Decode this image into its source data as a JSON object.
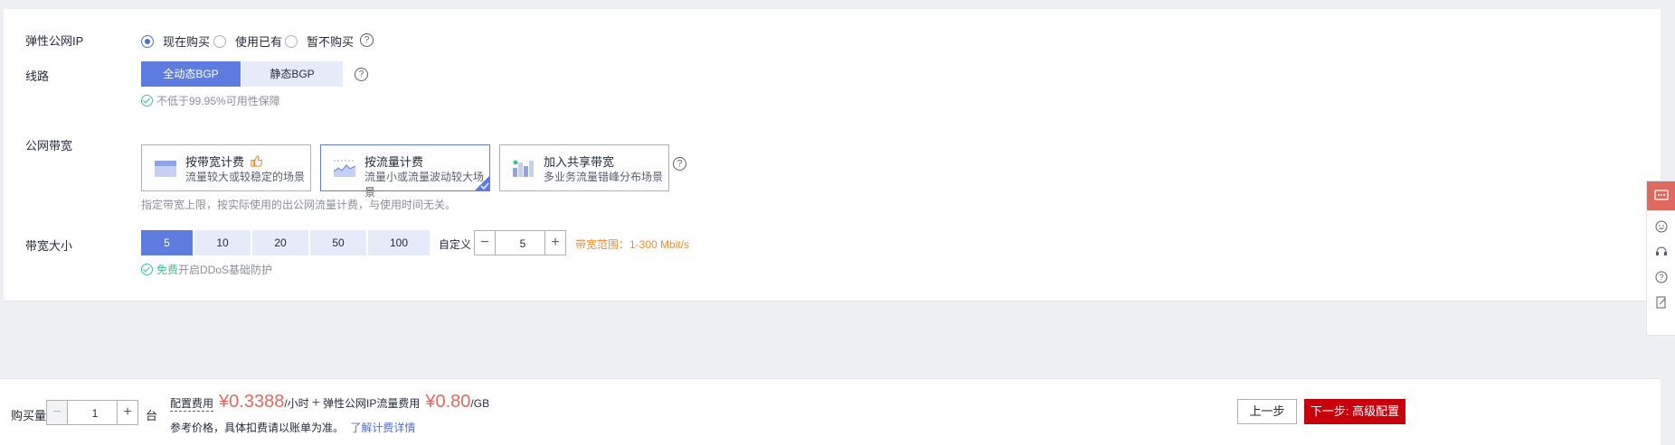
{
  "eip": {
    "label": "弹性公网IP",
    "options": [
      {
        "label": "现在购买",
        "checked": true
      },
      {
        "label": "使用已有",
        "checked": false
      },
      {
        "label": "暂不购买",
        "checked": false
      }
    ]
  },
  "line": {
    "label": "线路",
    "options": [
      {
        "label": "全动态BGP",
        "selected": true
      },
      {
        "label": "静态BGP",
        "selected": false
      }
    ],
    "note": "不低于99.95%可用性保障"
  },
  "bandwidth": {
    "label": "公网带宽",
    "cards": [
      {
        "title": "按带宽计费",
        "subtitle": "流量较大或较稳定的场景",
        "selected": false,
        "icon": "bandwidth-billing-icon"
      },
      {
        "title": "按流量计费",
        "subtitle": "流量小或流量波动较大场景",
        "selected": true,
        "icon": "traffic-billing-icon"
      },
      {
        "title": "加入共享带宽",
        "subtitle": "多业务流量错峰分布场景",
        "selected": false,
        "icon": "shared-bandwidth-icon"
      }
    ],
    "note": "指定带宽上限，按实际使用的出公网流量计费，与使用时间无关。"
  },
  "size": {
    "label": "带宽大小",
    "options": [
      "5",
      "10",
      "20",
      "50",
      "100"
    ],
    "selected": "5",
    "custom_label": "自定义",
    "custom_value": "5",
    "range_text": "带宽范围：1-300 Mbit/s",
    "ddos_free": "免费",
    "ddos_text": "开启DDoS基础防护"
  },
  "footer": {
    "qty_label": "购买量",
    "qty_value": "1",
    "unit": "台",
    "config_fee_label": "配置费用",
    "config_price": "¥0.3388",
    "config_unit": "/小时",
    "plus": "+",
    "eip_fee_label": "弹性公网IP流量费用",
    "eip_price": "¥0.80",
    "eip_unit": "/GB",
    "reference": "参考价格，具体扣费请以账单为准。",
    "detail_link": "了解计费详情",
    "prev_label": "上一步",
    "next_label": "下一步: 高级配置"
  },
  "colors": {
    "primary": "#5e7ce0",
    "price": "#e0695f",
    "next_button": "#c7000b",
    "success": "#3ac295",
    "range_text": "#ed8b29"
  }
}
